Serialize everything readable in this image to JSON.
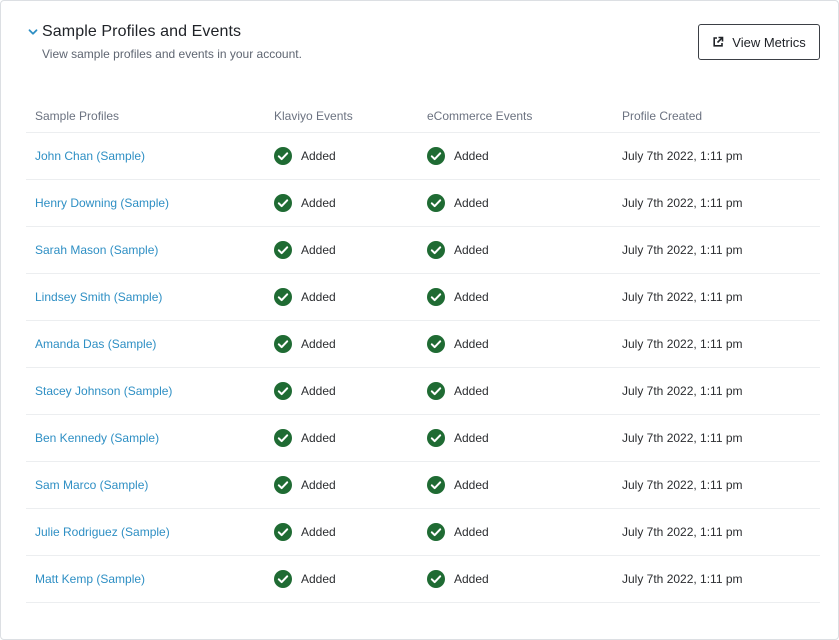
{
  "header": {
    "title": "Sample Profiles and Events",
    "subtitle": "View sample profiles and events in your account.",
    "button_label": "View Metrics"
  },
  "table": {
    "columns": [
      "Sample Profiles",
      "Klaviyo Events",
      "eCommerce Events",
      "Profile Created"
    ],
    "rows": [
      {
        "name": "John Chan (Sample)",
        "klaviyo": "Added",
        "ecommerce": "Added",
        "created": "July 7th 2022, 1:11 pm"
      },
      {
        "name": "Henry Downing (Sample)",
        "klaviyo": "Added",
        "ecommerce": "Added",
        "created": "July 7th 2022, 1:11 pm"
      },
      {
        "name": "Sarah Mason (Sample)",
        "klaviyo": "Added",
        "ecommerce": "Added",
        "created": "July 7th 2022, 1:11 pm"
      },
      {
        "name": "Lindsey Smith (Sample)",
        "klaviyo": "Added",
        "ecommerce": "Added",
        "created": "July 7th 2022, 1:11 pm"
      },
      {
        "name": "Amanda Das (Sample)",
        "klaviyo": "Added",
        "ecommerce": "Added",
        "created": "July 7th 2022, 1:11 pm"
      },
      {
        "name": "Stacey Johnson (Sample)",
        "klaviyo": "Added",
        "ecommerce": "Added",
        "created": "July 7th 2022, 1:11 pm"
      },
      {
        "name": "Ben Kennedy (Sample)",
        "klaviyo": "Added",
        "ecommerce": "Added",
        "created": "July 7th 2022, 1:11 pm"
      },
      {
        "name": "Sam Marco (Sample)",
        "klaviyo": "Added",
        "ecommerce": "Added",
        "created": "July 7th 2022, 1:11 pm"
      },
      {
        "name": "Julie Rodriguez (Sample)",
        "klaviyo": "Added",
        "ecommerce": "Added",
        "created": "July 7th 2022, 1:11 pm"
      },
      {
        "name": "Matt Kemp (Sample)",
        "klaviyo": "Added",
        "ecommerce": "Added",
        "created": "July 7th 2022, 1:11 pm"
      }
    ]
  },
  "icons": {
    "collapse": "chevron-down-icon",
    "external": "external-link-icon",
    "status": "check-circle-icon"
  },
  "colors": {
    "link": "#2e8fc4",
    "accent_chevron": "#2e8fc4",
    "success": "#1f6b33"
  }
}
